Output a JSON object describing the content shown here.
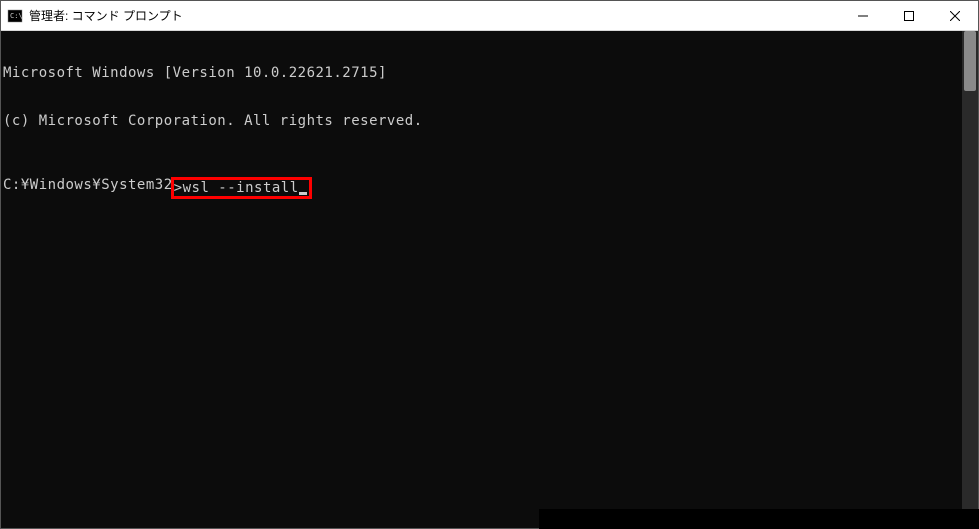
{
  "window": {
    "title": "管理者: コマンド プロンプト"
  },
  "terminal": {
    "line1": "Microsoft Windows [Version 10.0.22621.2715]",
    "line2": "(c) Microsoft Corporation. All rights reserved.",
    "prompt_prefix": "C:¥Windows¥System32",
    "prompt_char": ">",
    "command": "wsl --install"
  }
}
